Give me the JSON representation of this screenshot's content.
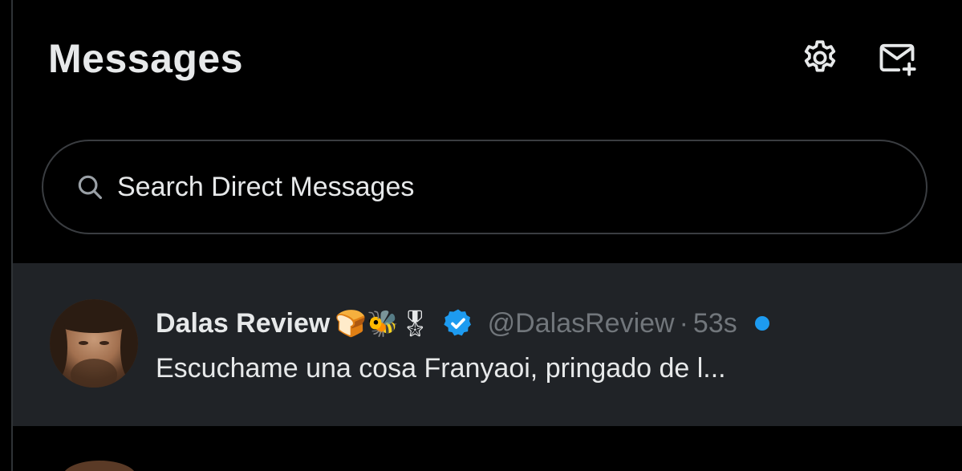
{
  "header": {
    "title": "Messages",
    "settings_icon": "gear-icon",
    "new_message_icon": "new-message-icon"
  },
  "search": {
    "placeholder": "Search Direct Messages",
    "value": ""
  },
  "conversations": [
    {
      "name": "Dalas Review",
      "emojis": "🍞🐝🎖",
      "verified": true,
      "handle": "@DalasReview",
      "separator": "·",
      "time": "53s",
      "preview": "Escuchame una cosa Franyaoi, pringado de l...",
      "unread": true
    }
  ],
  "colors": {
    "background": "#000000",
    "selected_row": "#202327",
    "accent": "#1d9bf0",
    "muted_text": "#71767b",
    "primary_text": "#e7e9ea"
  }
}
